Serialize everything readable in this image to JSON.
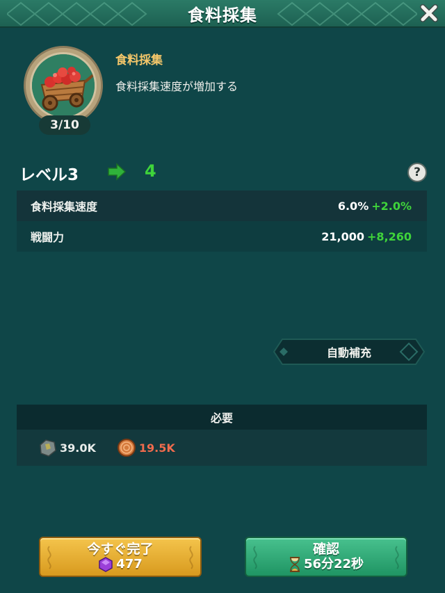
{
  "header": {
    "title": "食料採集"
  },
  "skill": {
    "name": "食料採集",
    "description": "食料採集速度が増加する",
    "progress": "3/10"
  },
  "level": {
    "current": "レベル3",
    "next": "4"
  },
  "stats": [
    {
      "label": "食料採集速度",
      "current": "6.0%",
      "bonus": "+2.0%"
    },
    {
      "label": "戦闘力",
      "current": "21,000",
      "bonus": "+8,260"
    }
  ],
  "auto_button": {
    "label": "自動補充"
  },
  "requirements": {
    "title": "必要",
    "items": [
      {
        "icon": "stone-icon",
        "value": "39.0K",
        "status": "ok"
      },
      {
        "icon": "wood-log-icon",
        "value": "19.5K",
        "status": "short"
      }
    ]
  },
  "buttons": {
    "instant": {
      "label": "今すぐ完了",
      "cost": "477",
      "icon": "gem-icon"
    },
    "confirm": {
      "label": "確認",
      "time": "56分22秒",
      "icon": "hourglass-icon"
    }
  },
  "colors": {
    "background": "#0f4648",
    "accent_gold": "#f5c76a",
    "bonus_green": "#3fd43a",
    "shortage_red": "#f06b4d"
  }
}
